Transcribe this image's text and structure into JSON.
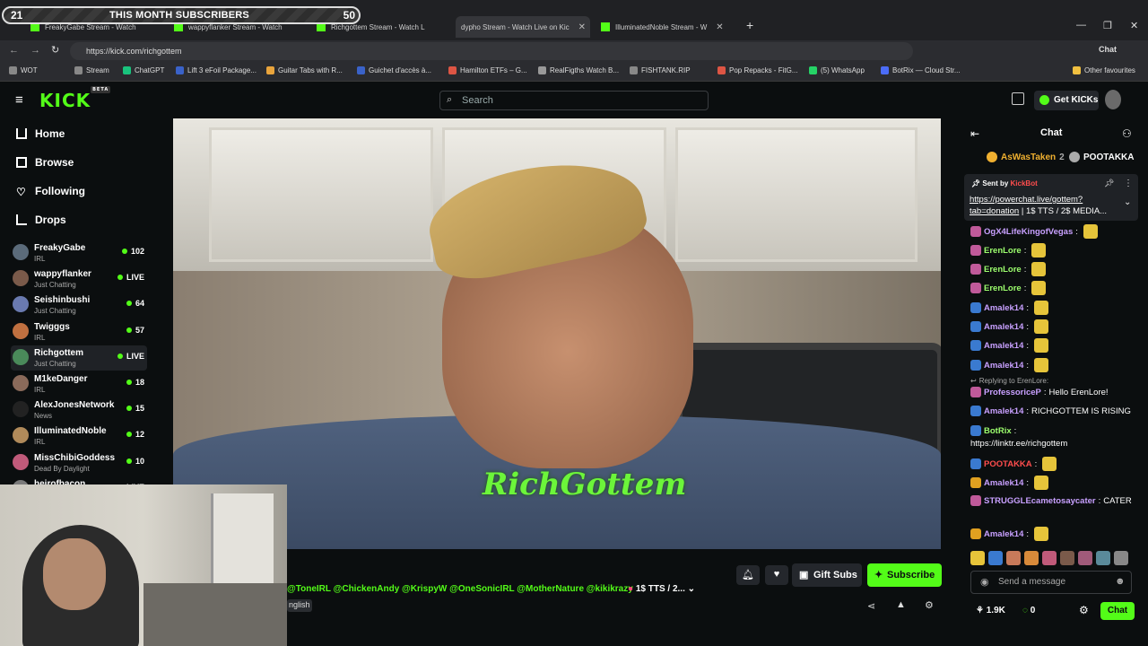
{
  "overlay": {
    "left_num": "21",
    "title": "THIS MONTH SUBSCRIBERS",
    "right_num": "50"
  },
  "tabs": [
    {
      "label": "FreakyGabe Stream - Watch"
    },
    {
      "label": "wappyflanker Stream - Watch"
    },
    {
      "label": "Richgottem Stream - Watch L"
    },
    {
      "label": "dypho Stream - Watch Live on Kic"
    },
    {
      "label": "IlluminatedNoble Stream - W"
    }
  ],
  "address": {
    "url": "https://kick.com/richgottem"
  },
  "bookmarks": [
    {
      "label": "WOT",
      "color": "#888"
    },
    {
      "label": "Stream",
      "color": "#888"
    },
    {
      "label": "ChatGPT",
      "color": "#19c37d"
    },
    {
      "label": "Lift 3 eFoil Package...",
      "color": "#3a62c9"
    },
    {
      "label": "Guitar Tabs with R...",
      "color": "#e9a43c"
    },
    {
      "label": "Guichet d'accès à...",
      "color": "#3a62c9"
    },
    {
      "label": "Hamilton ETFs – G...",
      "color": "#d54"
    },
    {
      "label": "RealFigths Watch B...",
      "color": "#999"
    },
    {
      "label": "FISHTANK.RIP",
      "color": "#888"
    },
    {
      "label": "Pop Repacks - FitG...",
      "color": "#d54"
    },
    {
      "label": "(5) WhatsApp",
      "color": "#25d366"
    },
    {
      "label": "BotRix — Cloud Str...",
      "color": "#4b6cf7"
    },
    {
      "label": "Other favourites",
      "color": "#f0c040"
    }
  ],
  "header": {
    "search_placeholder": "Search",
    "get_kicks": "Get KICKs"
  },
  "nav": [
    {
      "label": "Home"
    },
    {
      "label": "Browse"
    },
    {
      "label": "Following"
    },
    {
      "label": "Drops"
    }
  ],
  "channels": [
    {
      "name": "FreakyGabe",
      "category": "IRL",
      "viewers": "102",
      "avatar": "#5b6b7a"
    },
    {
      "name": "wappyflanker",
      "category": "Just Chatting",
      "viewers": "LIVE",
      "avatar": "#7a5a4a"
    },
    {
      "name": "Seishinbushi",
      "category": "Just Chatting",
      "viewers": "64",
      "avatar": "#6a7ab0"
    },
    {
      "name": "Twigggs",
      "category": "IRL",
      "viewers": "57",
      "avatar": "#c07040"
    },
    {
      "name": "Richgottem",
      "category": "Just Chatting",
      "viewers": "LIVE",
      "avatar": "#4a8a5a"
    },
    {
      "name": "M1keDanger",
      "category": "IRL",
      "viewers": "18",
      "avatar": "#8a6a5a"
    },
    {
      "name": "AlexJonesNetwork",
      "category": "News",
      "viewers": "15",
      "avatar": "#222"
    },
    {
      "name": "IlluminatedNoble",
      "category": "IRL",
      "viewers": "12",
      "avatar": "#b08a5a"
    },
    {
      "name": "MissChibiGoddess",
      "category": "Dead By Daylight",
      "viewers": "10",
      "avatar": "#c05a7a"
    },
    {
      "name": "heirofbacon",
      "category": "",
      "viewers": "LIVE",
      "avatar": "#7a7a7a"
    }
  ],
  "video": {
    "logo_text": "RichGottem"
  },
  "stream_info": {
    "tags": "@ToneIRL  @ChickenAndy  @KrispyW  @OneSonicIRL  @MotherNature  @kikikrazy",
    "tts": "1$ TTS / 2...",
    "language": "nglish",
    "gift_subs": "Gift Subs",
    "subscribe": "Subscribe"
  },
  "chat": {
    "title": "Chat",
    "leaderboard": [
      {
        "name": "AsWasTaken",
        "count": "2"
      },
      {
        "name": "POOTAKKA",
        "count": ""
      }
    ],
    "pinned": {
      "sent_by": "Sent by",
      "sender": "KickBot",
      "link": "https://powerchat.live/gottem?tab=donation",
      "rest": " | 1$ TTS / 2$ MEDIA..."
    },
    "messages": [
      {
        "user": "OgX4LifeKingofVegas",
        "text": "",
        "color": "#c8a0ff"
      },
      {
        "user": "ErenLore",
        "text": "",
        "color": "#9dff6e"
      },
      {
        "user": "ErenLore",
        "text": "",
        "color": "#9dff6e"
      },
      {
        "user": "ErenLore",
        "text": "",
        "color": "#9dff6e"
      },
      {
        "user": "Amalek14",
        "text": "",
        "color": "#c8a0ff"
      },
      {
        "user": "Amalek14",
        "text": "",
        "color": "#c8a0ff"
      },
      {
        "user": "Amalek14",
        "text": "",
        "color": "#c8a0ff"
      },
      {
        "user": "Amalek14",
        "text": "",
        "color": "#c8a0ff"
      },
      {
        "user": "ProfessoriceP",
        "text": "Hello ErenLore!",
        "color": "#c8a0ff"
      },
      {
        "user": "Amalek14",
        "text": "RICHGOTTEM IS RISING",
        "color": "#c8a0ff"
      },
      {
        "user": "BotRix",
        "text": "https://linktr.ee/richgottem",
        "color": "#9dff6e"
      },
      {
        "user": "POOTAKKA",
        "text": "",
        "color": "#ff4d4d"
      },
      {
        "user": "Amalek14",
        "text": "",
        "color": "#c8a0ff"
      },
      {
        "user": "STRUGGLEcametosaycater",
        "text": "CATER",
        "color": "#c8a0ff"
      },
      {
        "user": "Amalek14",
        "text": "",
        "color": "#c8a0ff"
      }
    ],
    "reply_to": "Replying to ErenLore:",
    "input_placeholder": "Send a message",
    "send_label": "Chat",
    "kicks_count": "1.9K",
    "zero_count": "0"
  },
  "colors": {
    "accent": "#53fc18",
    "bg": "#0b0e0f"
  }
}
